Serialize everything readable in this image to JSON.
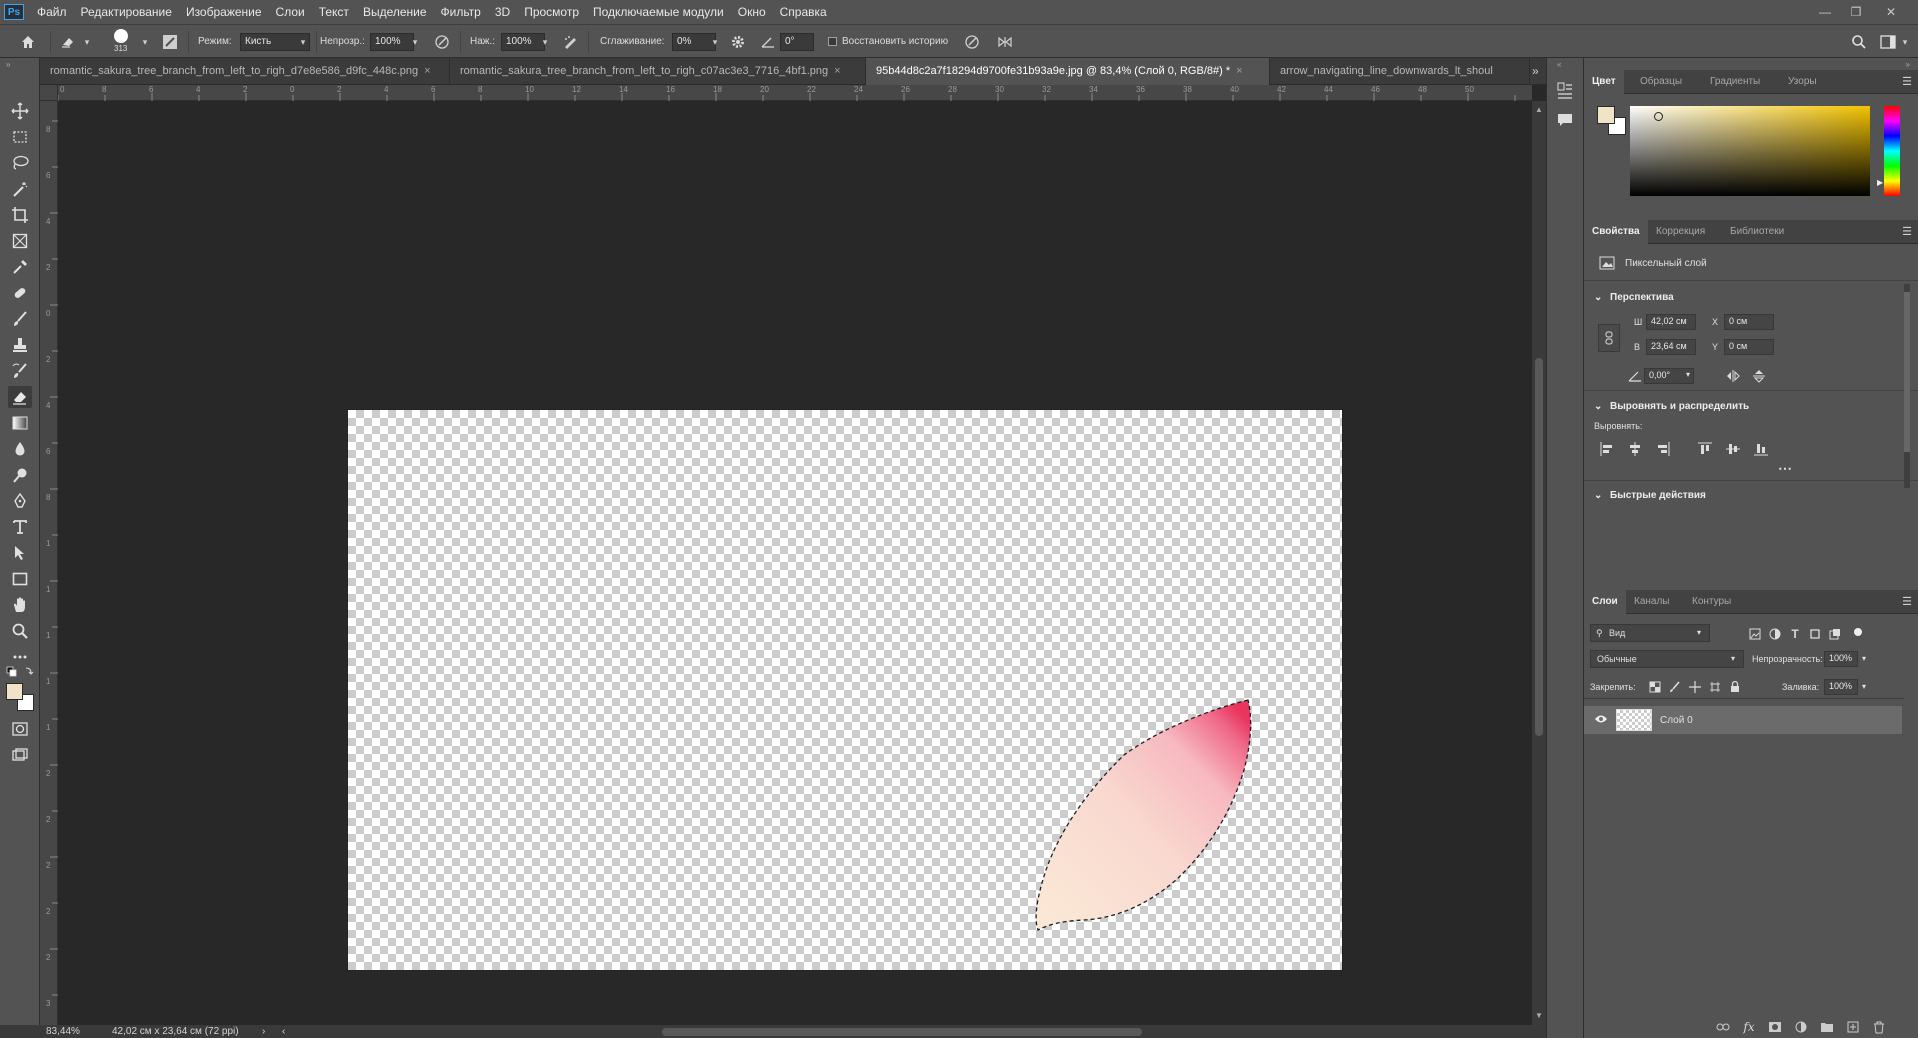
{
  "menubar": {
    "logo": "Ps",
    "items": [
      "Файл",
      "Редактирование",
      "Изображение",
      "Слои",
      "Текст",
      "Выделение",
      "Фильтр",
      "3D",
      "Просмотр",
      "Подключаемые модули",
      "Окно",
      "Справка"
    ]
  },
  "options": {
    "brush_size": "313",
    "mode_label": "Режим:",
    "mode_value": "Кисть",
    "opacity_label": "Непрозр.:",
    "opacity_value": "100%",
    "pressure_label": "Наж.:",
    "pressure_value": "100%",
    "smoothing_label": "Сглаживание:",
    "smoothing_value": "0%",
    "angle_value": "0°",
    "restore_history_label": "Восстановить историю"
  },
  "tabs": [
    {
      "label": "romantic_sakura_tree_branch_from_left_to_righ_d7e8e586_d9fc_448c.png"
    },
    {
      "label": "romantic_sakura_tree_branch_from_left_to_righ_c07ac3e3_7716_4bf1.png"
    },
    {
      "label": "95b44d8c2a7f18294d9700fe31b93a9e.jpg @ 83,4% (Слой 0, RGB/8#) *"
    },
    {
      "label": "arrow_navigating_line_downwards_lt_shoul"
    }
  ],
  "ruler": {
    "h_ticks": [
      "0",
      "8",
      "6",
      "4",
      "2",
      "0",
      "2",
      "4",
      "6",
      "8",
      "10",
      "12",
      "14",
      "16",
      "18",
      "20",
      "22",
      "24",
      "26",
      "28",
      "30",
      "32",
      "34",
      "36",
      "38",
      "40",
      "42",
      "44",
      "46",
      "48",
      "50"
    ],
    "v_ticks": [
      "8",
      "6",
      "4",
      "2",
      "0",
      "2",
      "4",
      "6",
      "8",
      "1",
      "1",
      "1",
      "1",
      "1",
      "2",
      "2",
      "2",
      "2",
      "2",
      "3",
      "3"
    ]
  },
  "status": {
    "zoom": "83,44%",
    "doc_size": "42,02 см x 23,64 см (72 ppi)"
  },
  "color_panel": {
    "tabs": [
      "Цвет",
      "Образцы",
      "Градиенты",
      "Узоры"
    ],
    "foreground": "#f0e3c8",
    "background": "#ffffff",
    "hue": "#f2c200"
  },
  "properties": {
    "tabs": [
      "Свойства",
      "Коррекция",
      "Библиотеки"
    ],
    "layer_type": "Пиксельный слой",
    "section_perspective": "Перспектива",
    "w_label": "Ш",
    "w_value": "42,02 см",
    "h_label": "В",
    "h_value": "23,64 см",
    "x_label": "X",
    "x_value": "0 см",
    "y_label": "Y",
    "y_value": "0 см",
    "angle_value": "0,00°",
    "section_align": "Выровнять и распределить",
    "align_label": "Выровнять:",
    "section_quick": "Быстрые действия"
  },
  "layers": {
    "tabs": [
      "Слои",
      "Каналы",
      "Контуры"
    ],
    "filter_label": "Вид",
    "blend_mode": "Обычные",
    "opacity_label": "Непрозрачность:",
    "opacity_value": "100%",
    "lock_label": "Закрепить:",
    "fill_label": "Заливка:",
    "fill_value": "100%",
    "items": [
      {
        "name": "Слой 0"
      }
    ]
  }
}
